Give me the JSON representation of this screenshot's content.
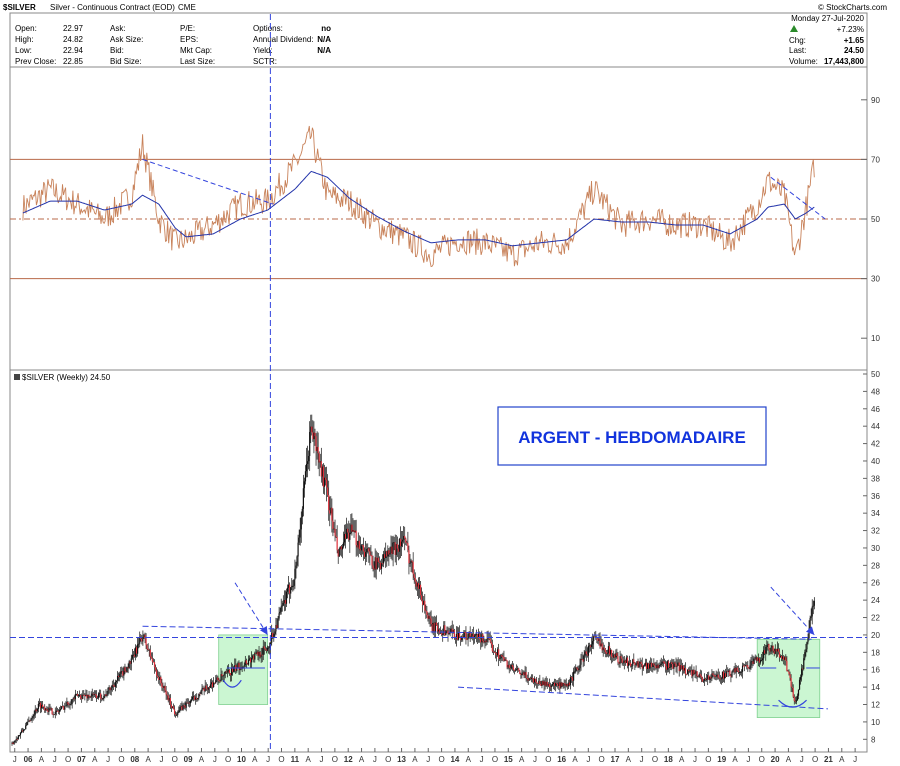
{
  "header": {
    "symbol": "$SILVER",
    "description": "Silver - Continuous Contract (EOD)",
    "exchange": "CME",
    "watermark": "© StockCharts.com",
    "date": "Monday  27-Jul-2020",
    "col1": [
      {
        "label": "Open:",
        "value": "22.97"
      },
      {
        "label": "High:",
        "value": "24.82"
      },
      {
        "label": "Low:",
        "value": "22.94"
      },
      {
        "label": "Prev Close:",
        "value": "22.85"
      }
    ],
    "col2": [
      {
        "label": "Ask:",
        "value": ""
      },
      {
        "label": "Ask Size:",
        "value": ""
      },
      {
        "label": "Bid:",
        "value": ""
      },
      {
        "label": "Bid Size:",
        "value": ""
      }
    ],
    "col3": [
      {
        "label": "P/E:",
        "value": ""
      },
      {
        "label": "EPS:",
        "value": ""
      },
      {
        "label": "Mkt Cap:",
        "value": ""
      },
      {
        "label": "Last Size:",
        "value": ""
      }
    ],
    "col4": [
      {
        "label": "Options:",
        "value": "no"
      },
      {
        "label": "Annual Dividend:",
        "value": "N/A"
      },
      {
        "label": "Yield:",
        "value": "N/A"
      },
      {
        "label": "SCTR:",
        "value": ""
      }
    ],
    "change_pct": "+7.23%",
    "col5": [
      {
        "label": "Chg:",
        "value": "+1.65"
      },
      {
        "label": "Last:",
        "value": "24.50"
      },
      {
        "label": "Volume:",
        "value": "17,443,800"
      }
    ]
  },
  "colors": {
    "rsi_line": "#c8825a",
    "rsi_ma": "#2233aa",
    "ref_line": "#b86a4a",
    "candle": "#111111",
    "trend": "#3344dd",
    "highlight_fill": "#a8f0b4",
    "label_text": "#1133dd"
  },
  "price_panel_label": "$SILVER (Weekly) 24.50",
  "annotation": "ARGENT - HEBDOMADAIRE",
  "chart_data": [
    {
      "type": "line",
      "name": "indicator-panel",
      "ylim": [
        0,
        100
      ],
      "yticks": [
        10,
        30,
        50,
        70,
        90
      ],
      "reference_lines": [
        30,
        50,
        70
      ],
      "anchors_x": [
        2006.0,
        2006.5,
        2007.0,
        2007.5,
        2008.0,
        2008.2,
        2008.5,
        2008.8,
        2009.0,
        2009.5,
        2010.0,
        2010.5,
        2011.0,
        2011.3,
        2011.6,
        2012.0,
        2012.5,
        2013.0,
        2013.5,
        2014.0,
        2014.5,
        2015.0,
        2015.5,
        2016.0,
        2016.5,
        2017.0,
        2017.5,
        2018.0,
        2018.5,
        2019.0,
        2019.5,
        2019.7,
        2020.0,
        2020.2,
        2020.4,
        2020.55
      ],
      "rsi_values": [
        54,
        60,
        55,
        50,
        58,
        75,
        50,
        42,
        43,
        48,
        55,
        56,
        68,
        78,
        58,
        56,
        48,
        44,
        38,
        43,
        42,
        38,
        42,
        42,
        60,
        48,
        50,
        48,
        48,
        42,
        55,
        63,
        58,
        37,
        54,
        68
      ],
      "ma_values": [
        52,
        56,
        56,
        53,
        55,
        58,
        55,
        47,
        44,
        45,
        50,
        53,
        60,
        66,
        64,
        57,
        51,
        46,
        42,
        43,
        43,
        41,
        42,
        43,
        50,
        49,
        49,
        48,
        48,
        45,
        50,
        54,
        55,
        50,
        52,
        54
      ]
    },
    {
      "type": "candlestick",
      "name": "price-panel",
      "ylim": [
        7,
        50
      ],
      "yticks": [
        8,
        10,
        12,
        14,
        16,
        18,
        20,
        22,
        24,
        26,
        28,
        30,
        32,
        34,
        36,
        38,
        40,
        42,
        44,
        46,
        48,
        50
      ],
      "x_tick_labels": [
        "J",
        "06",
        "A",
        "J",
        "O",
        "07",
        "A",
        "J",
        "O",
        "08",
        "A",
        "J",
        "O",
        "09",
        "A",
        "J",
        "O",
        "10",
        "A",
        "J",
        "O",
        "11",
        "A",
        "J",
        "O",
        "12",
        "A",
        "J",
        "O",
        "13",
        "A",
        "J",
        "O",
        "14",
        "A",
        "J",
        "O",
        "15",
        "A",
        "J",
        "O",
        "16",
        "A",
        "J",
        "O",
        "17",
        "A",
        "J",
        "O",
        "18",
        "A",
        "J",
        "O",
        "19",
        "A",
        "J",
        "O",
        "20",
        "A",
        "J",
        "O",
        "21",
        "A",
        "J"
      ],
      "anchors_x": [
        2005.8,
        2006.0,
        2006.3,
        2006.6,
        2007.0,
        2007.5,
        2008.0,
        2008.2,
        2008.5,
        2008.8,
        2009.0,
        2009.5,
        2010.0,
        2010.5,
        2011.0,
        2011.3,
        2011.6,
        2011.8,
        2012.0,
        2012.5,
        2013.0,
        2013.5,
        2014.0,
        2014.5,
        2015.0,
        2015.5,
        2016.0,
        2016.5,
        2017.0,
        2017.5,
        2018.0,
        2018.5,
        2019.0,
        2019.5,
        2019.7,
        2020.0,
        2020.2,
        2020.4,
        2020.55
      ],
      "close_values": [
        7.5,
        9,
        12,
        11,
        13,
        13,
        17,
        20,
        15,
        11,
        12,
        14.5,
        16.5,
        18.5,
        27,
        44,
        36,
        29,
        32,
        28,
        31,
        21,
        20,
        19.5,
        16,
        14.5,
        14,
        19.5,
        17,
        16.5,
        16.5,
        15,
        15.5,
        17,
        18.5,
        17.5,
        12,
        18.5,
        24.5
      ],
      "horizontal_level": 19.7,
      "trend_lines": [
        {
          "x": [
            2008.2,
            2020.5
          ],
          "y": [
            21,
            19.5
          ]
        },
        {
          "x": [
            2014.0,
            2020.8
          ],
          "y": [
            14,
            11.5
          ]
        }
      ],
      "arrows": [
        {
          "x": [
            2009.9,
            2010.5
          ],
          "y": [
            26,
            20
          ]
        },
        {
          "x": [
            2019.75,
            2020.55
          ],
          "y": [
            25.5,
            20
          ]
        }
      ],
      "highlight_zones": [
        {
          "x": [
            2009.6,
            2010.5
          ],
          "y": [
            12,
            20
          ]
        },
        {
          "x": [
            2019.5,
            2020.65
          ],
          "y": [
            10.5,
            19.5
          ]
        }
      ]
    }
  ]
}
